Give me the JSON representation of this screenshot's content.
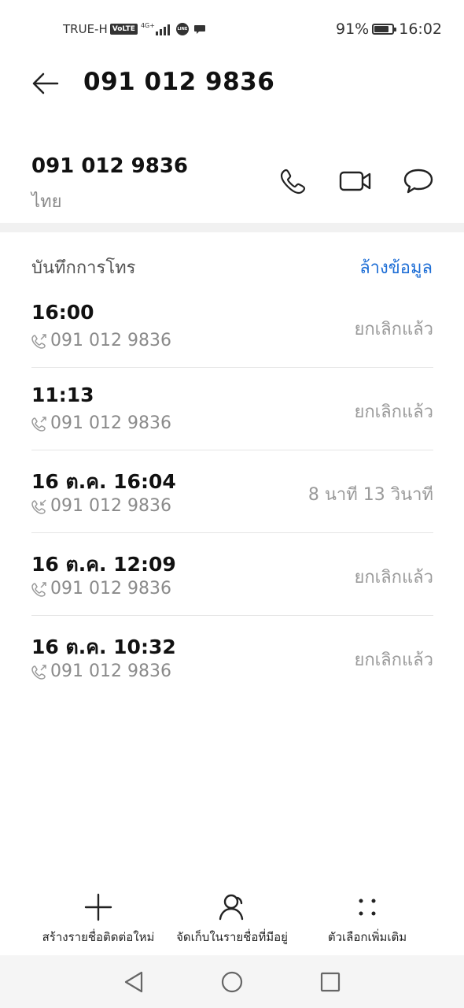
{
  "status_bar": {
    "carrier": "TRUE-H",
    "volte": "VoLTE",
    "network": "4G+",
    "line_badge": "LINE",
    "battery": "91%",
    "battery_level": 0.91,
    "time": "16:02"
  },
  "header": {
    "title": "091 012 9836"
  },
  "contact": {
    "number": "091 012 9836",
    "region": "ไทย",
    "actions": [
      "phone-icon",
      "video-call-icon",
      "message-icon"
    ]
  },
  "call_log": {
    "title": "บันทึกการโทร",
    "clear_label": "ล้างข้อมูล",
    "items": [
      {
        "time": "16:00",
        "number": "091 012 9836",
        "status": "ยกเลิกแล้ว",
        "direction": "outgoing"
      },
      {
        "time": "11:13",
        "number": "091 012 9836",
        "status": "ยกเลิกแล้ว",
        "direction": "outgoing"
      },
      {
        "time": "16 ต.ค. 16:04",
        "number": "091 012 9836",
        "status": "8 นาที 13 วินาที",
        "direction": "incoming"
      },
      {
        "time": "16 ต.ค. 12:09",
        "number": "091 012 9836",
        "status": "ยกเลิกแล้ว",
        "direction": "outgoing"
      },
      {
        "time": "16 ต.ค. 10:32",
        "number": "091 012 9836",
        "status": "ยกเลิกแล้ว",
        "direction": "outgoing"
      }
    ]
  },
  "bottom_actions": {
    "new_contact": "สร้างรายชื่อติดต่อใหม่",
    "save_existing": "จัดเก็บในรายชื่อที่มีอยู่",
    "more_options": "ตัวเลือกเพิ่มเติม"
  },
  "colors": {
    "accent": "#1f6fd6",
    "secondary_text": "#8a8a8a",
    "divider": "#e5e5e5"
  }
}
